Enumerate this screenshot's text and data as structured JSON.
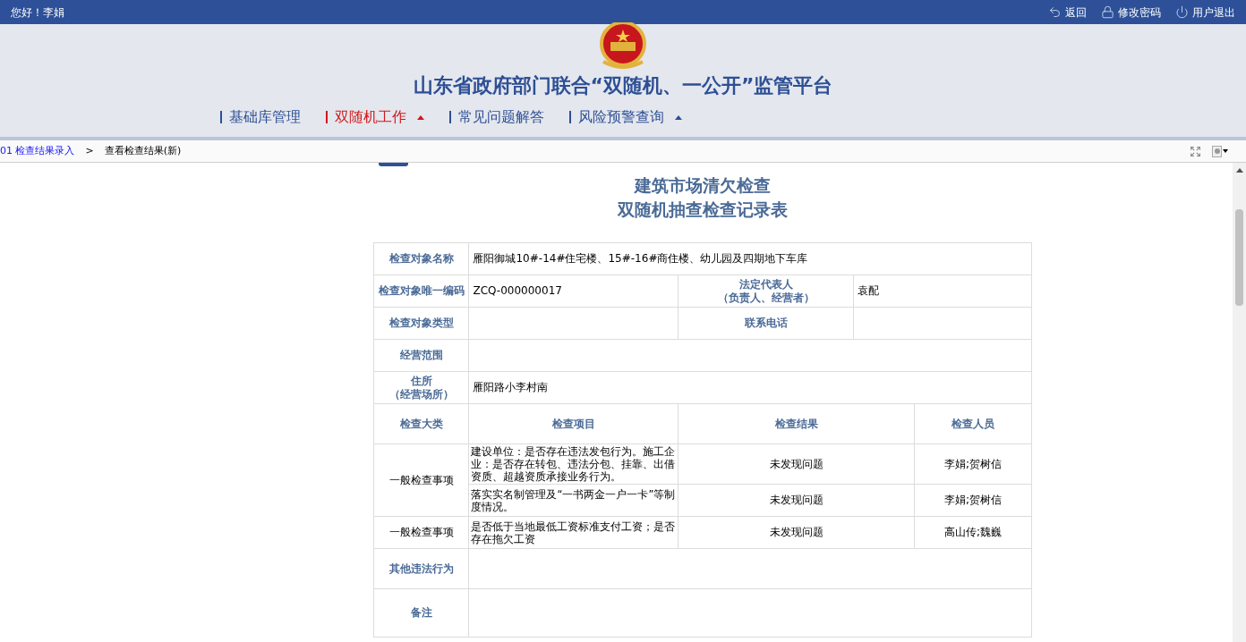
{
  "top_bar": {
    "greeting": "您好！李娟",
    "links": [
      {
        "kind": "back",
        "label": "返回"
      },
      {
        "kind": "password",
        "label": "修改密码"
      },
      {
        "kind": "logout",
        "label": "用户退出"
      }
    ]
  },
  "header": {
    "title": "山东省政府部门联合“双随机、一公开”监管平台"
  },
  "nav": [
    {
      "label": "基础库管理",
      "selected": false,
      "has_menu": false
    },
    {
      "label": "双随机工作",
      "selected": true,
      "has_menu": true
    },
    {
      "label": "常见问题解答",
      "selected": false,
      "has_menu": false
    },
    {
      "label": "风险预警查询",
      "selected": false,
      "has_menu": true
    }
  ],
  "breadcrumb": {
    "link": "01 检查结果录入",
    "separator": ">",
    "current": "查看检查结果(新)"
  },
  "form": {
    "title_lines": [
      "建筑市场清欠检查",
      "双随机抽查检查记录表"
    ],
    "info_rows": [
      {
        "label": [
          "检查对象名称"
        ],
        "value": "雁阳御城10#-14#住宅楼、15#-16#商住楼、幼儿园及四期地下车库"
      },
      {
        "label": [
          "检查对象唯一编码"
        ],
        "value": "ZCQ-000000017",
        "label_2": [
          "法定代表人",
          "（负责人、经营者）"
        ],
        "value_2": "袁配"
      },
      {
        "label": [
          "检查对象类型"
        ],
        "label_2": [
          "联系电话"
        ]
      },
      {
        "label": [
          "经营范围"
        ]
      },
      {
        "label": [
          "住所",
          "（经营场所）"
        ],
        "value": "雁阳路小李村南"
      }
    ],
    "check_columns": [
      "检查大类",
      "检查项目",
      "检查结果",
      "检查人员"
    ],
    "check_groups": [
      {
        "category": "一般检查事项",
        "items": [
          {
            "item": "建设单位：是否存在违法发包行为。施工企业：是否存在转包、违法分包、挂靠、出借资质、超越资质承接业务行为。",
            "result": "未发现问题",
            "inspectors": "李娟;贺树信"
          },
          {
            "item": "落实实名制管理及“一书两金一户一卡”等制度情况。",
            "result": "未发现问题",
            "inspectors": "李娟;贺树信"
          }
        ]
      },
      {
        "category": "一般检查事项",
        "items": [
          {
            "item": "是否低于当地最低工资标准支付工资；是否存在拖欠工资",
            "result": "未发现问题",
            "inspectors": "高山传;魏巍"
          }
        ]
      }
    ],
    "extra_rows": [
      {
        "label": "其他违法行为"
      },
      {
        "label": "备注"
      }
    ]
  }
}
